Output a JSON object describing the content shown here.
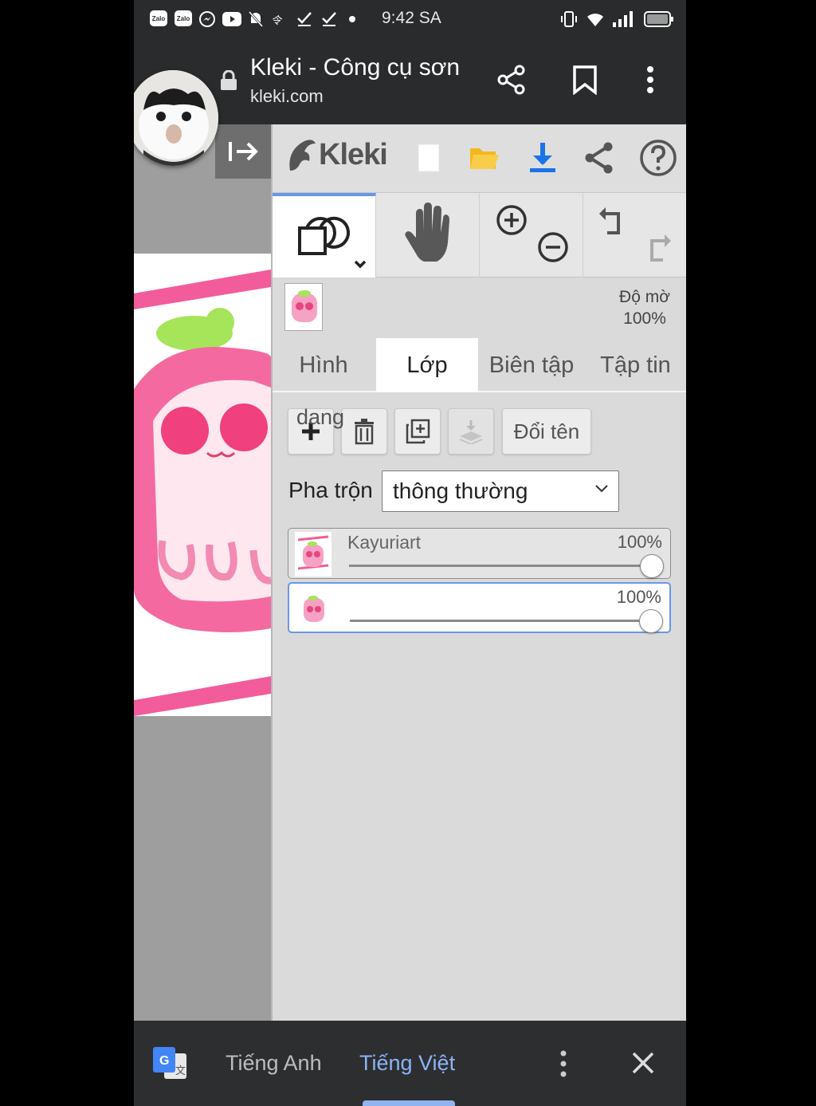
{
  "status_bar": {
    "time": "9:42 SA",
    "left_icons": [
      "zalo-icon",
      "zalo-icon",
      "messenger-icon",
      "youtube-icon",
      "bell-off-icon",
      "calendar-icon",
      "check-icon",
      "check-icon",
      "dot-icon"
    ],
    "right_icons": [
      "vibrate-icon",
      "wifi-icon",
      "signal-icon",
      "battery-icon"
    ],
    "zalo_text": "Zalo"
  },
  "browser": {
    "title": "Kleki - Công cụ sơn",
    "url": "kleki.com"
  },
  "kleki": {
    "logo": "Kleki",
    "opacity_label": "Độ mờ",
    "opacity_value": "100%",
    "tabs": [
      {
        "label": "Hình",
        "active": false
      },
      {
        "label": "Lớp",
        "active": true
      },
      {
        "label": "Biên tập",
        "active": false
      },
      {
        "label": "Tập tin",
        "active": false
      }
    ],
    "overlay_text": "dang",
    "rename_button": "Đổi tên",
    "blend_label": "Pha trộn",
    "blend_value": "thông thường",
    "layers": [
      {
        "name": "Kayuriart",
        "opacity": "100%",
        "selected": false,
        "slider_value": 1.0
      },
      {
        "name": "",
        "opacity": "100%",
        "selected": true,
        "slider_value": 1.0
      }
    ]
  },
  "translate_bar": {
    "source_lang": "Tiếng Anh",
    "target_lang": "Tiếng Việt"
  },
  "colors": {
    "accent_blue": "#1a73e8",
    "selection_blue": "#6a96e8",
    "translate_active": "#8ab4f8",
    "artwork_pink": "#f25c9a"
  }
}
